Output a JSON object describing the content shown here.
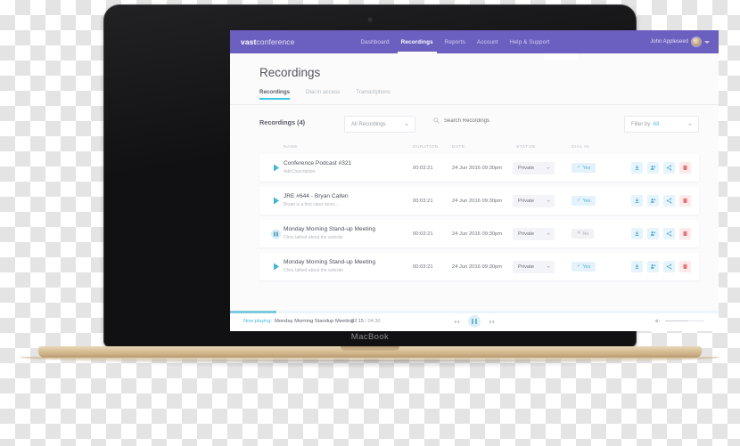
{
  "device": {
    "brand_label": "MacBook"
  },
  "topnav": {
    "brand_bold": "vast",
    "brand_light": "conference",
    "links": [
      {
        "label": "Dashboard",
        "active": false
      },
      {
        "label": "Recordings",
        "active": true
      },
      {
        "label": "Reports",
        "active": false
      },
      {
        "label": "Account",
        "active": false
      },
      {
        "label": "Help & Support",
        "active": false
      }
    ],
    "user_name": "John Appleseed",
    "accent_color": "#6b5fc0"
  },
  "page": {
    "title": "Recordings",
    "tabs": [
      {
        "label": "Recordings",
        "active": true
      },
      {
        "label": "Dial in access",
        "active": false
      },
      {
        "label": "Transcriptions",
        "active": false
      }
    ],
    "tab_accent": "#3cc4e0"
  },
  "toolbar": {
    "count_label": "Recordings (4)",
    "sort_select": "All Recordings",
    "search_placeholder": "Search Recordings",
    "search_value": "",
    "filter_label": "Filter by",
    "filter_value": "All"
  },
  "table": {
    "headers": [
      "NAME",
      "DURATION",
      "DATE",
      "STATUS",
      "DIAL IN"
    ],
    "rows": [
      {
        "name": "Conference Podcast #321",
        "description": "Add Description",
        "duration": "00:03:21",
        "date": "24 Jun 2016 09:30pm",
        "status": "Private",
        "dial_in": "Yes",
        "dial_in_state": "yes",
        "playing": false
      },
      {
        "name": "JRE #644 - Bryan Callen",
        "description": "Bryan is a first class moro...",
        "duration": "00:03:21",
        "date": "24 Jun 2016 09:30pm",
        "status": "Private",
        "dial_in": "Yes",
        "dial_in_state": "yes",
        "playing": false
      },
      {
        "name": "Monday Morning Stand-up Meeting",
        "description": "Chris talked about the website",
        "duration": "00:03:21",
        "date": "24 Jun 2016 09:30pm",
        "status": "Private",
        "dial_in": "No",
        "dial_in_state": "no",
        "playing": true
      },
      {
        "name": "Monday Morning Stand-up Meeting",
        "description": "Chris talked about the website",
        "duration": "00:03:21",
        "date": "24 Jun 2016 09:30pm",
        "status": "Private",
        "dial_in": "Yes",
        "dial_in_state": "yes",
        "playing": false
      }
    ],
    "row_actions": [
      "download-icon",
      "add-user-icon",
      "share-icon",
      "delete-icon"
    ]
  },
  "player": {
    "now_playing_label": "Now playing:",
    "track_title": "Monday Morning Standup Meeting",
    "current_time": "02:15",
    "time_separator": " / ",
    "total_time": "04:30",
    "progress_percent": 9.5,
    "volume_percent": 58,
    "state": "playing",
    "accent_color": "#43bcd8"
  }
}
